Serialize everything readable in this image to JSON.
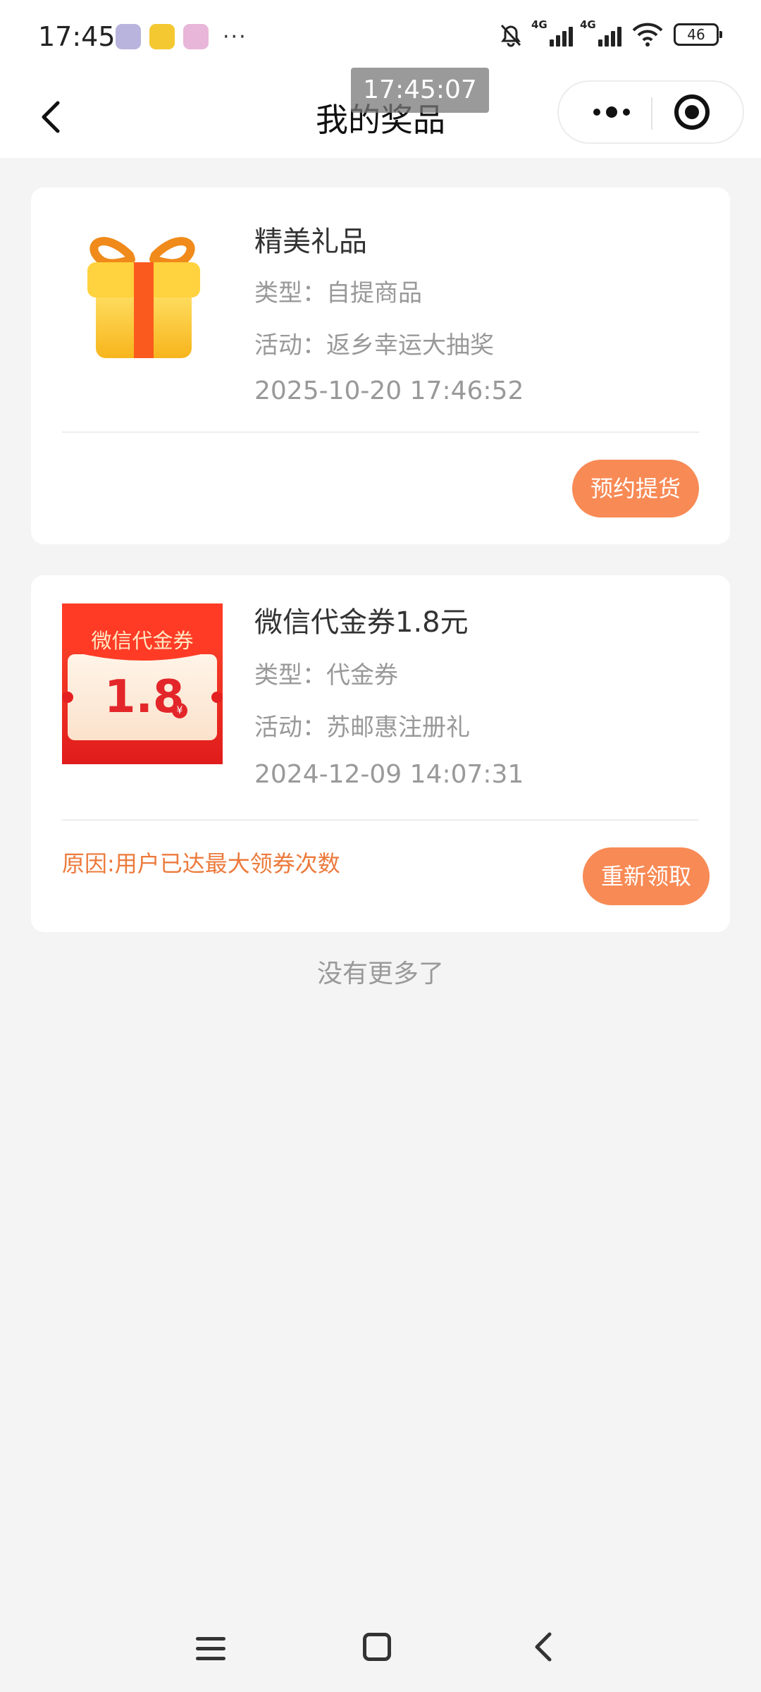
{
  "status_bar": {
    "time": "17:45",
    "network_1": "4G",
    "network_2": "4G",
    "battery": "46"
  },
  "overlay_time": "17:45:07",
  "nav": {
    "title": "我的奖品"
  },
  "prizes": [
    {
      "title": "精美礼品",
      "type_line": "类型：自提商品",
      "activity_line": "活动：返乡幸运大抽奖",
      "date": "2025-10-20 17:46:52",
      "button": "预约提货"
    },
    {
      "title": "微信代金券1.8元",
      "type_line": "类型：代金券",
      "activity_line": "活动：苏邮惠注册礼",
      "date": "2024-12-09 14:07:31",
      "reason": "原因:用户已达最大领券次数",
      "button": "重新领取",
      "coupon_heading": "微信代金券",
      "coupon_amount": "1.8",
      "coupon_currency": "¥"
    }
  ],
  "footer_text": "没有更多了",
  "colors": {
    "accent_button": "#f88a55",
    "reason_text": "#ec7a3c",
    "page_bg": "#f4f4f4"
  }
}
